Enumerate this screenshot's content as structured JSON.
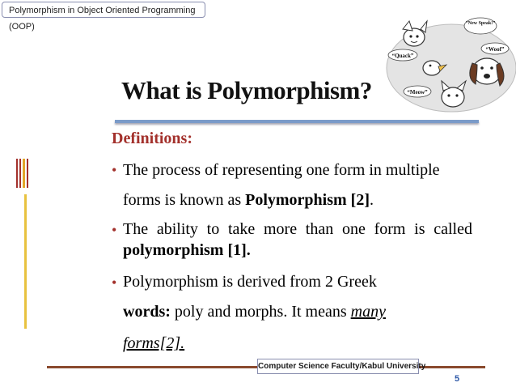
{
  "header": {
    "title": "Polymorphism in Object Oriented Programming (OOP)"
  },
  "cartoon": {
    "speech": [
      "“New Speak!”",
      "“Woof”",
      "“Quack”",
      "“Meow”"
    ]
  },
  "slide": {
    "title": "What is Polymorphism?",
    "definitions_label": "Definitions:",
    "bullet_glyph": "•",
    "b1_line1": "The process of representing one form in multiple",
    "b1_line2_pre": "forms is known as ",
    "b1_line2_bold": "Polymorphism [2]",
    "b1_line2_post": ".",
    "b2_line1": "The ability to take more than one form is called",
    "b2_line2": "polymorphism [1].",
    "b3_line1": "Polymorphism is derived from 2 Greek",
    "b3_line2_bold": "words:",
    "b3_line2_rest": " poly and morphs. It means ",
    "b3_line2_emph": "many",
    "b3_line3": "forms[2]."
  },
  "footer": {
    "affiliation": "Computer Science Faculty/Kabul University",
    "page_number": "5"
  },
  "colors": {
    "accent_red": "#a3312c",
    "title_rule_blue": "#7b9bc9",
    "footer_rule_brown": "#8a4a2e",
    "page_number_blue": "#2f5aa8"
  }
}
